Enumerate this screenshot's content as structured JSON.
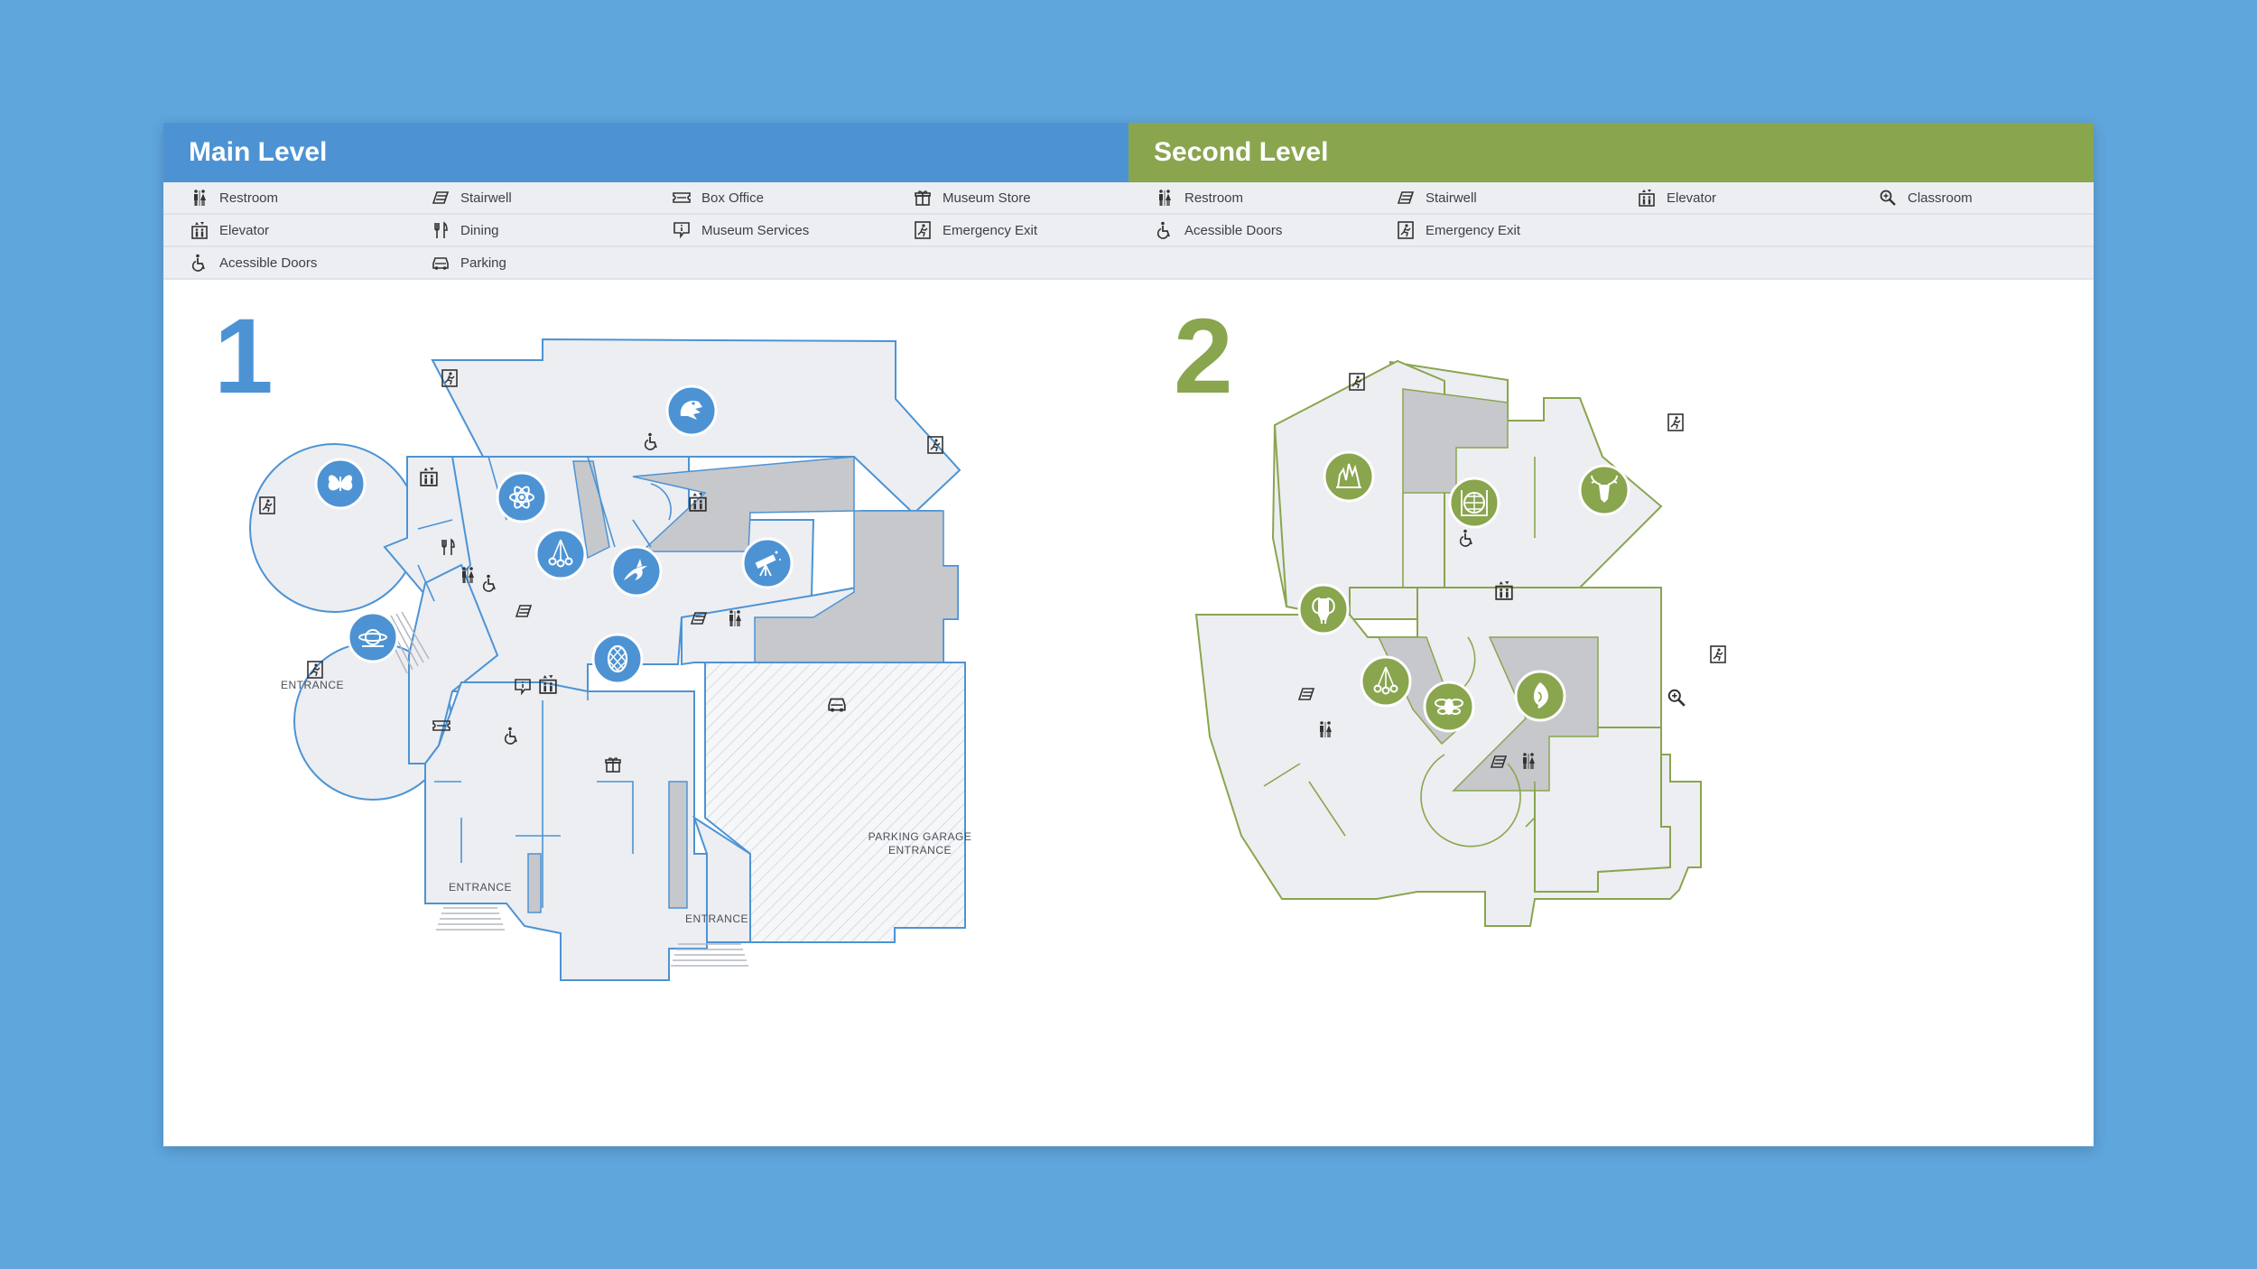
{
  "main_level": {
    "title": "Main Level",
    "number": "1",
    "accent": "#4d93d4",
    "legend": [
      {
        "label": "Restroom",
        "icon": "restroom-icon"
      },
      {
        "label": "Stairwell",
        "icon": "stairwell-icon"
      },
      {
        "label": "Box Office",
        "icon": "ticket-icon"
      },
      {
        "label": "Museum Store",
        "icon": "gift-icon"
      },
      {
        "label": "Elevator",
        "icon": "elevator-icon"
      },
      {
        "label": "Dining",
        "icon": "dining-icon"
      },
      {
        "label": "Museum Services",
        "icon": "services-icon"
      },
      {
        "label": "Emergency Exit",
        "icon": "exit-icon"
      },
      {
        "label": "Acessible Doors",
        "icon": "accessible-icon"
      },
      {
        "label": "Parking",
        "icon": "car-icon"
      }
    ],
    "labels": {
      "entrance_west": "ENTRANCE",
      "entrance_south": "ENTRANCE",
      "entrance_southeast": "ENTRANCE",
      "parking_garage_line1": "PARKING GARAGE",
      "parking_garage_line2": "ENTRANCE"
    },
    "exhibits": [
      "dinosaur-icon",
      "butterfly-icon",
      "atom-icon",
      "pendulum-icon",
      "shark-icon",
      "telescope-icon",
      "planetarium-icon",
      "egg-icon"
    ]
  },
  "second_level": {
    "title": "Second Level",
    "number": "2",
    "accent": "#89a54e",
    "legend": [
      {
        "label": "Restroom",
        "icon": "restroom-icon"
      },
      {
        "label": "Stairwell",
        "icon": "stairwell-icon"
      },
      {
        "label": "Elevator",
        "icon": "elevator-icon"
      },
      {
        "label": "Classroom",
        "icon": "classroom-icon"
      },
      {
        "label": "Acessible Doors",
        "icon": "accessible-icon"
      },
      {
        "label": "Emergency Exit",
        "icon": "exit-icon"
      }
    ],
    "exhibits": [
      "crystal-icon",
      "globe-icon",
      "skull-icon",
      "elephant-icon",
      "pendulum-icon",
      "bee-icon",
      "shell-icon"
    ]
  }
}
